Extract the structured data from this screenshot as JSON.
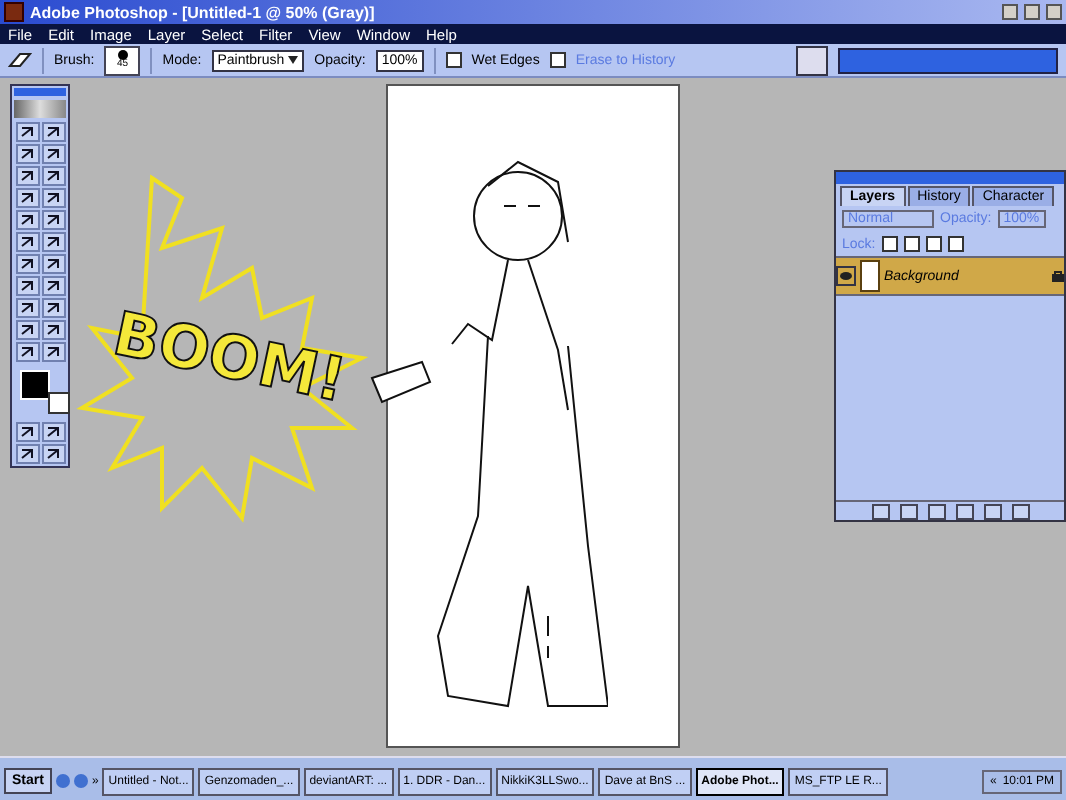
{
  "window": {
    "title": "Adobe Photoshop - [Untitled-1 @ 50% (Gray)]"
  },
  "menu": [
    "File",
    "Edit",
    "Image",
    "Layer",
    "Select",
    "Filter",
    "View",
    "Window",
    "Help"
  ],
  "options_bar": {
    "brush_label": "Brush:",
    "brush_size": "45",
    "mode_label": "Mode:",
    "mode": "Paintbrush",
    "opacity_label": "Opacity:",
    "opacity": "100%",
    "wet_edges": {
      "label": "Wet Edges",
      "checked": false,
      "disabled": false
    },
    "erase_to_history": {
      "label": "Erase to History",
      "checked": false,
      "disabled": true
    }
  },
  "artwork": {
    "lettering": "BOOM!"
  },
  "layers_panel": {
    "tabs": [
      {
        "label": "Layers",
        "selected": true
      },
      {
        "label": "History",
        "selected": false
      },
      {
        "label": "Character",
        "selected": false
      }
    ],
    "blend_mode": "Normal",
    "opacity_label": "Opacity:",
    "opacity": "100%",
    "lock_label": "Lock:",
    "layers": [
      {
        "name": "Background",
        "selected": true,
        "visible": true,
        "locked": true
      }
    ]
  },
  "taskbar": {
    "start": "Start",
    "more": "»",
    "tasks": [
      {
        "label": "Untitled - Not...",
        "selected": false
      },
      {
        "label": "Genzomaden_...",
        "selected": false
      },
      {
        "label": "deviantART: ...",
        "selected": false
      },
      {
        "label": "1. DDR - Dan...",
        "selected": false
      },
      {
        "label": "NikkiK3LLSwo...",
        "selected": false
      },
      {
        "label": "Dave at BnS ...",
        "selected": false
      },
      {
        "label": "Adobe Phot...",
        "selected": true
      },
      {
        "label": "MS_FTP LE R...",
        "selected": false
      }
    ],
    "tray_expand": "«",
    "clock": "10:01 PM"
  }
}
